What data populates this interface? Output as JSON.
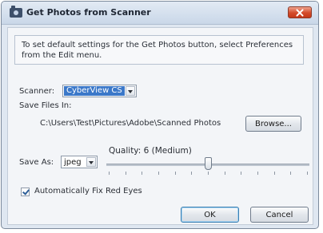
{
  "window": {
    "title": "Get Photos from Scanner",
    "close_label": "✕"
  },
  "info": {
    "message": "To set default settings for the Get Photos button, select Preferences from the Edit menu."
  },
  "scanner": {
    "label": "Scanner:",
    "selected": "CyberView CS"
  },
  "save_files": {
    "label": "Save Files In:",
    "path": "C:\\Users\\Test\\Pictures\\Adobe\\Scanned Photos",
    "browse_label": "Browse..."
  },
  "quality": {
    "label": "Quality: 6 (Medium)",
    "value": 6,
    "min": 0,
    "max": 12
  },
  "save_as": {
    "label": "Save As:",
    "selected": "jpeg"
  },
  "red_eye": {
    "label": "Automatically Fix Red Eyes",
    "checked": true
  },
  "buttons": {
    "ok": "OK",
    "cancel": "Cancel"
  },
  "colors": {
    "selection": "#3b78c9",
    "close": "#d44b2a",
    "window_bg": "#dfe7f1"
  }
}
